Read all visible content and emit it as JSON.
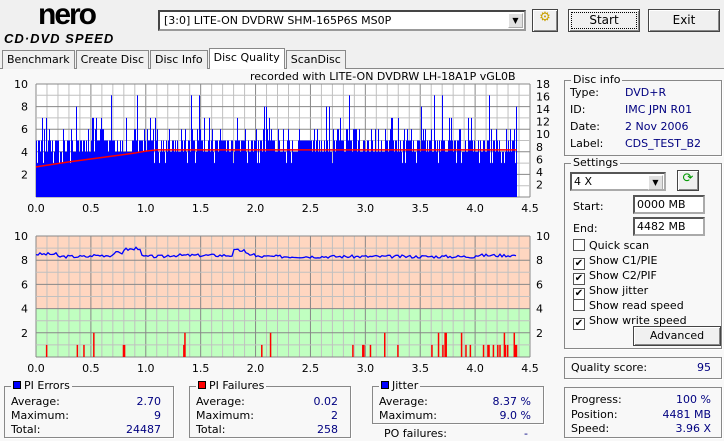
{
  "app": {
    "logo_top": "nero",
    "logo_bottom": "CD·DVD SPEED"
  },
  "toolbar": {
    "drive": "[3:0]  LITE-ON DVDRW SHM-165P6S MS0P",
    "start_label": "Start",
    "exit_label": "Exit"
  },
  "tabs": [
    {
      "label": "Benchmark"
    },
    {
      "label": "Create Disc"
    },
    {
      "label": "Disc Info"
    },
    {
      "label": "Disc Quality",
      "active": true
    },
    {
      "label": "ScanDisc"
    }
  ],
  "recorded_with": "recorded with LITE-ON DVDRW LH-18A1P   vGL0B",
  "disc_info": {
    "title": "Disc info",
    "type_label": "Type:",
    "type": "DVD+R",
    "id_label": "ID:",
    "id": "IMC JPN R01",
    "date_label": "Date:",
    "date": "2 Nov 2006",
    "label_label": "Label:",
    "label": "CDS_TEST_B2"
  },
  "settings": {
    "title": "Settings",
    "speed": "4 X",
    "start_label": "Start:",
    "start": "0000 MB",
    "end_label": "End:",
    "end": "4482 MB",
    "checks": [
      {
        "label": "Quick scan",
        "checked": false
      },
      {
        "label": "Show C1/PIE",
        "checked": true
      },
      {
        "label": "Show C2/PIF",
        "checked": true
      },
      {
        "label": "Show jitter",
        "checked": true
      },
      {
        "label": "Show read speed",
        "checked": false
      },
      {
        "label": "Show write speed",
        "checked": true
      }
    ],
    "advanced_label": "Advanced"
  },
  "quality": {
    "label": "Quality score:",
    "value": "95"
  },
  "progress": {
    "progress_label": "Progress:",
    "progress": "100 %",
    "position_label": "Position:",
    "position": "4481 MB",
    "speed_label": "Speed:",
    "speed": "3.96 X"
  },
  "pi_errors": {
    "title": "PI Errors",
    "color": "#0000ff",
    "avg_label": "Average:",
    "avg": "2.70",
    "max_label": "Maximum:",
    "max": "9",
    "total_label": "Total:",
    "total": "24487"
  },
  "pi_failures": {
    "title": "PI Failures",
    "color": "#ff0000",
    "avg_label": "Average:",
    "avg": "0.02",
    "max_label": "Maximum:",
    "max": "2",
    "total_label": "Total:",
    "total": "258"
  },
  "jitter": {
    "title": "Jitter",
    "color": "#0000ff",
    "avg_label": "Average:",
    "avg": "8.37 %",
    "max_label": "Maximum:",
    "max": "9.0 %",
    "po_label": "PO failures:",
    "po": "-"
  },
  "chart_data": [
    {
      "type": "bar",
      "xlim": [
        0,
        4.5
      ],
      "ylim": [
        0,
        10
      ],
      "y2lim": [
        0,
        18
      ],
      "xticks": [
        "0.0",
        "0.5",
        "1.0",
        "1.5",
        "2.0",
        "2.5",
        "3.0",
        "3.5",
        "4.0",
        "4.5"
      ],
      "yticks": [
        "2",
        "4",
        "6",
        "8",
        "10"
      ],
      "y2ticks": [
        "2",
        "4",
        "6",
        "8",
        "10",
        "12",
        "14",
        "16",
        "18"
      ],
      "series": [
        {
          "kind": "pie_bars",
          "color": "#0000ff",
          "x_end": 4.38,
          "step": 0.1,
          "max_values": [
            7,
            7,
            6,
            8,
            8,
            7,
            9,
            7,
            7,
            9,
            7,
            6,
            6,
            9,
            9,
            7,
            6,
            7,
            7,
            8,
            8,
            7,
            6,
            7,
            5,
            7,
            8,
            7,
            9,
            6,
            6,
            9,
            7,
            7,
            7,
            8,
            9,
            7,
            6,
            7,
            5,
            9,
            8,
            8
          ],
          "base": 4
        },
        {
          "kind": "write_speed",
          "color": "#ff0000",
          "x": [
            0,
            0.3,
            0.6,
            0.9,
            1.0,
            1.1,
            4.38
          ],
          "y": [
            4.8,
            5.6,
            6.3,
            7.0,
            7.3,
            7.5,
            7.5
          ]
        }
      ]
    },
    {
      "type": "bar+line",
      "xlim": [
        0,
        4.5
      ],
      "ylim": [
        0,
        10
      ],
      "xticks": [
        "0.0",
        "0.5",
        "1.0",
        "1.5",
        "2.0",
        "2.5",
        "3.0",
        "3.5",
        "4.0",
        "4.5"
      ],
      "yticks": [
        "2",
        "4",
        "6",
        "8",
        "10"
      ],
      "series": [
        {
          "kind": "jitter",
          "color": "#0000ff",
          "x": [
            0,
            0.2,
            0.5,
            0.7,
            0.8,
            0.9,
            0.95,
            1.2,
            1.5,
            1.8,
            1.9,
            2.0,
            2.5,
            3.0,
            3.5,
            4.0,
            4.38
          ],
          "y": [
            8.5,
            8.3,
            8.4,
            8.6,
            8.9,
            9.0,
            8.3,
            8.4,
            8.4,
            8.8,
            8.5,
            8.3,
            8.3,
            8.3,
            8.3,
            8.4,
            8.3
          ]
        },
        {
          "kind": "pif_bars",
          "color": "#ff0000",
          "x": [
            0.09,
            0.37,
            0.43,
            0.52,
            0.79,
            0.8,
            1.34,
            1.35,
            2.05,
            2.13,
            2.88,
            2.97,
            2.98,
            3.04,
            3.17,
            3.29,
            3.6,
            3.66,
            3.7,
            3.72,
            3.73,
            3.87,
            3.91,
            3.95,
            4.07,
            4.11,
            4.12,
            4.16,
            4.2,
            4.22,
            4.26,
            4.27,
            4.29,
            4.35,
            4.36,
            4.37
          ],
          "y": [
            1,
            1,
            1,
            2,
            1,
            1,
            1,
            2,
            1,
            2,
            1,
            1,
            1,
            1,
            2,
            1,
            1,
            2,
            1,
            2,
            2,
            2,
            1,
            1,
            1,
            1,
            1,
            1,
            1,
            1,
            2,
            1,
            1,
            2,
            1,
            1
          ]
        }
      ]
    }
  ]
}
